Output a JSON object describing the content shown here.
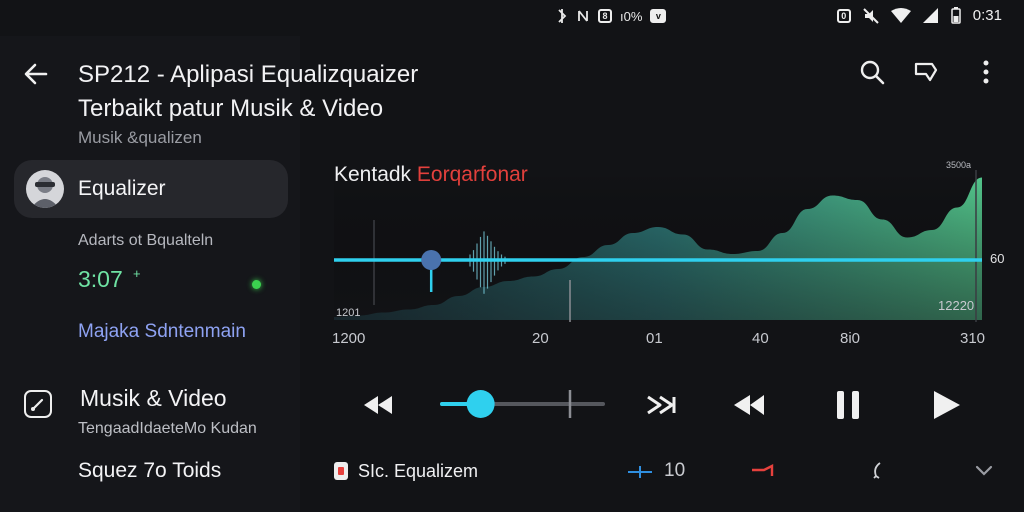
{
  "status_bar": {
    "left_icons": [
      "vibrate-icon",
      "nfc-icon",
      "notification-icon"
    ],
    "left_text": "ı0%",
    "clock": "0:31",
    "right_icons": [
      "alarm-icon",
      "mute-icon",
      "wifi-icon",
      "signal-icon",
      "battery-icon"
    ]
  },
  "header": {
    "title_line1": "SP212 - Aplipasi Equalizquaizer",
    "title_line2": "Terbaikt patur Musik & Video",
    "subtitle": "Musik &qualizen",
    "actions": [
      "search-icon",
      "cast-icon",
      "more-vert-icon"
    ]
  },
  "sidebar": {
    "equalizer_label": "Equalizer",
    "line1": "Adarts ot Bqualteln",
    "time": "3:07",
    "time_suffix": "+",
    "link": "Majaka Sdntenmain",
    "musik_video": "Musik & Video",
    "musik_video_sub": "TengaadIdaeteMo Kudan",
    "footer": "Squez 7o Toids"
  },
  "chart": {
    "title_plain": "Kentadk ",
    "title_accent": "Eorqarfonar",
    "top_right_label": "3500a",
    "right_label": "60",
    "inner_left_label": "1201",
    "inner_right_label": "12220",
    "x_labels": [
      "1200",
      "20",
      "01",
      "40",
      "8i0",
      "310"
    ]
  },
  "chart_data": {
    "type": "area",
    "title": "Kentadk Eorqarfonar",
    "x_tick_labels": [
      "1200",
      "20",
      "01",
      "40",
      "8i0",
      "310"
    ],
    "series": [
      {
        "values": [
          0.02,
          0.03,
          0.05,
          0.07,
          0.1,
          0.16,
          0.22,
          0.26,
          0.29,
          0.34,
          0.42,
          0.5,
          0.58,
          0.62,
          0.57,
          0.47,
          0.44,
          0.46,
          0.58,
          0.74,
          0.83,
          0.8,
          0.67,
          0.55,
          0.6,
          0.75,
          0.95
        ]
      }
    ],
    "playhead": 0.15,
    "colors": {
      "baseline": "#2fd0ee",
      "area_top": "#4ecb8f",
      "area_bottom": "#1d3d48"
    }
  },
  "transport": {
    "buttons": [
      "rewind-icon",
      "skip-icon",
      "previous-icon",
      "pause-icon",
      "play-icon"
    ],
    "progress": 0.24
  },
  "bottom_bar": {
    "label": "SIc. Equalizem",
    "volume_value": "10",
    "icons": [
      "equalizer-badge-icon",
      "horizontal-slider-icon",
      "red-line-icon",
      "loop-icon",
      "chevron-down-icon"
    ]
  },
  "colors": {
    "accent_cyan": "#2fd0ee",
    "accent_green": "#6fe3a4",
    "accent_red": "#e6413d",
    "link_blue": "#8ea2f2"
  }
}
